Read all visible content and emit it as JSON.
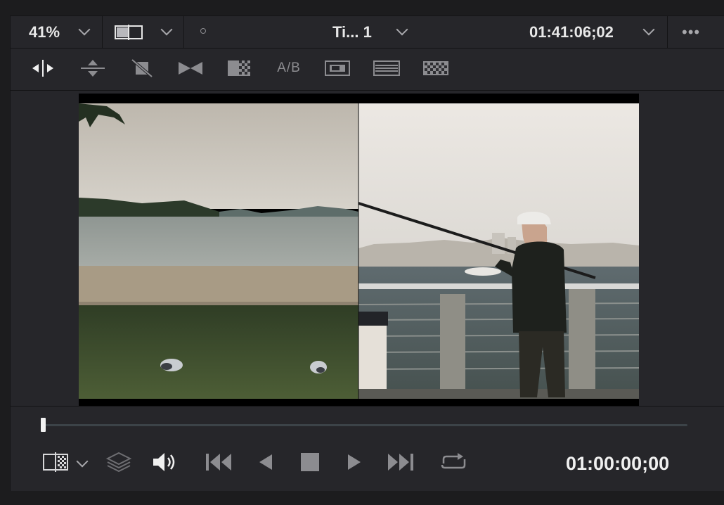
{
  "viewer_header": {
    "zoom": "41%",
    "timeline_name": "Ti... 1",
    "timecode": "01:41:06;02",
    "more_menu": "•••"
  },
  "toolbar": {
    "icons": [
      "split-wipe-horizontal-icon",
      "split-wipe-vertical-icon",
      "no-wipe-icon",
      "venetian-wipe-icon",
      "checker-wipe-icon",
      "ab-toggle-icon",
      "picture-in-picture-icon",
      "stripes-icon",
      "checkerboard-icon"
    ],
    "ab_label": "A/B"
  },
  "transport": {
    "timecode": "01:00:00;00",
    "playhead_fraction": 0.0
  },
  "colors": {
    "panel": "#26262a",
    "background": "#1c1c1e",
    "accent_text": "#e8e8e8",
    "icon_dim": "#8c8c90"
  }
}
